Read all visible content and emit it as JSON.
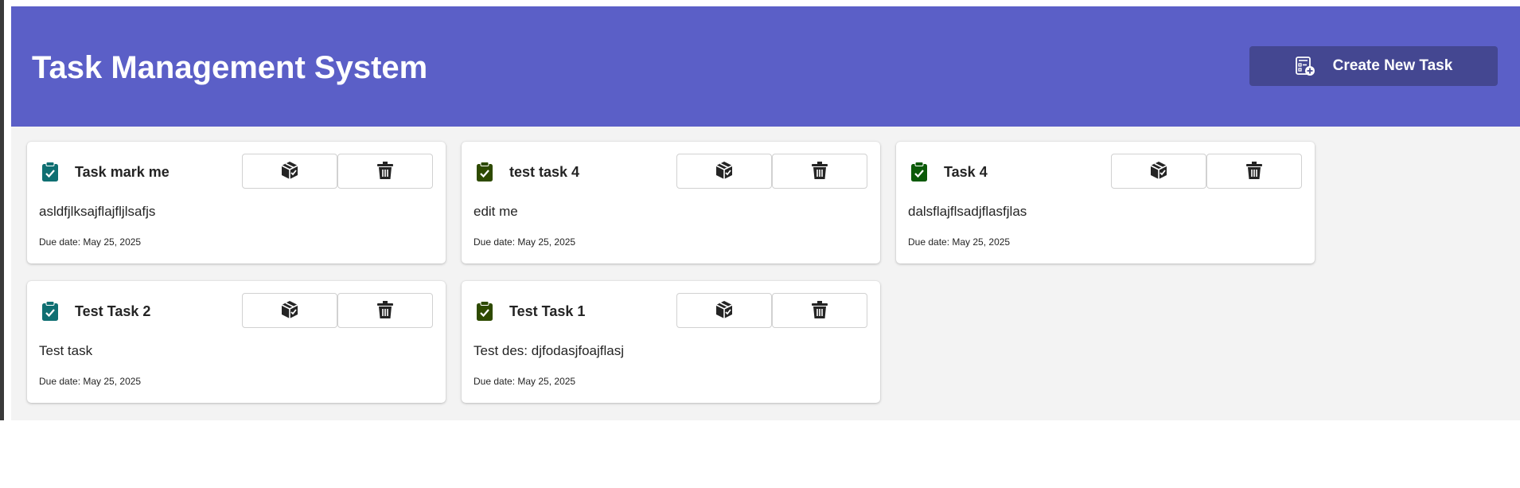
{
  "header": {
    "title": "Task Management System",
    "create_label": "Create New Task",
    "create_icon": "task-add-icon"
  },
  "colors": {
    "header_bg": "#5b5fc7",
    "create_button_bg": "#444791",
    "canvas_bg": "#f3f3f3",
    "status_teal": "#0f6f72",
    "status_olive": "#2e4a00",
    "status_green": "#0b5a08"
  },
  "card_common": {
    "archive_icon": "box-icon",
    "delete_icon": "trash-icon",
    "status_icon": "clipboard-check-icon"
  },
  "tasks": [
    {
      "title": "Task mark me",
      "description": "asldfjlksajflajfljlsafjs",
      "due": "Due date: May 25, 2025",
      "status_color": "#0f6f72"
    },
    {
      "title": "test task 4",
      "description": "edit me",
      "due": "Due date: May 25, 2025",
      "status_color": "#2e4a00"
    },
    {
      "title": "Task 4",
      "description": "dalsflajflsadjflasfjlas",
      "due": "Due date: May 25, 2025",
      "status_color": "#0b5a08"
    },
    {
      "title": "Test Task 2",
      "description": "Test task",
      "due": "Due date: May 25, 2025",
      "status_color": "#0f6f72"
    },
    {
      "title": "Test Task 1",
      "description": "Test des: djfodasjfoajflasj",
      "due": "Due date: May 25, 2025",
      "status_color": "#2e4a00"
    }
  ]
}
